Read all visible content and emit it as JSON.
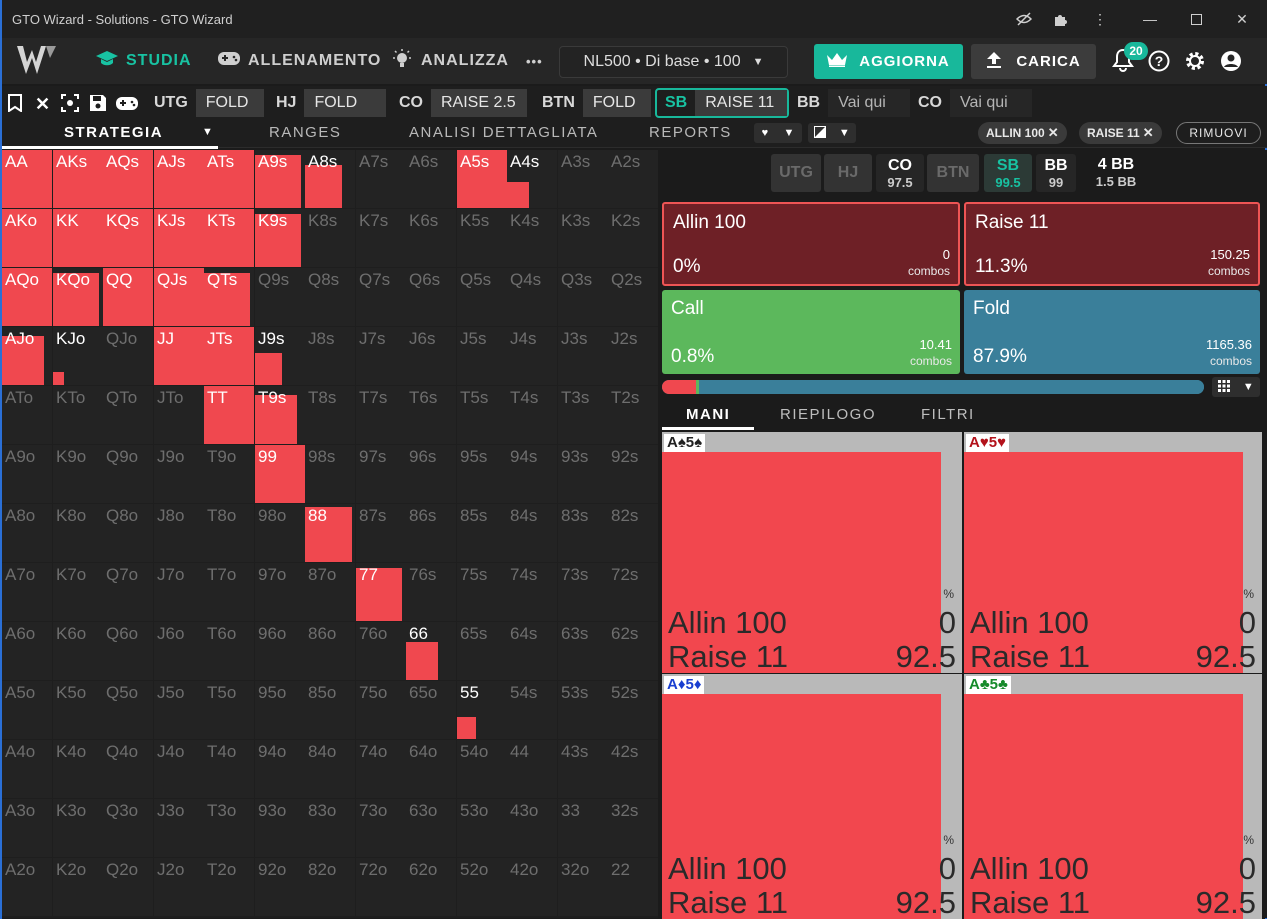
{
  "window": {
    "title": "GTO Wizard - Solutions - GTO Wizard"
  },
  "nav": {
    "studia": "STUDIA",
    "allenamento": "ALLENAMENTO",
    "analizza": "ANALIZZA",
    "more": "•••",
    "selector": "NL500 • Di base • 100",
    "aggiorna": "AGGIORNA",
    "carica": "CARICA",
    "notif_count": "20"
  },
  "actions": [
    {
      "pos": "UTG",
      "action": "FOLD"
    },
    {
      "pos": "HJ",
      "action": "FOLD"
    },
    {
      "pos": "CO",
      "action": "RAISE 2.5"
    },
    {
      "pos": "BTN",
      "action": "FOLD"
    },
    {
      "pos": "SB",
      "action": "RAISE 11"
    },
    {
      "pos": "BB",
      "action": "Vai qui"
    },
    {
      "pos": "CO",
      "action": "Vai qui"
    }
  ],
  "tabs": {
    "strategia": "STRATEGIA",
    "ranges": "RANGES",
    "analisi": "ANALISI DETTAGLIATA",
    "reports": "REPORTS"
  },
  "chips": {
    "allin": "ALLIN 100",
    "raise": "RAISE 11",
    "rimuovi": "RIMUOVI"
  },
  "colors": {
    "raise": "#f0484f",
    "call": "#5cb85c",
    "fold": "#3a7f9a",
    "allin": "#7a1f24",
    "accent": "#18b89b"
  },
  "grid": [
    [
      [
        "AA",
        1
      ],
      [
        "AKs",
        1
      ],
      [
        "AQs",
        1
      ],
      [
        "AJs",
        1
      ],
      [
        "ATs",
        1
      ],
      [
        "A9s",
        0.85
      ],
      [
        "A8s",
        0.55
      ],
      [
        "A7s",
        0
      ],
      [
        "A6s",
        0
      ],
      [
        "A5s",
        1
      ],
      [
        "A4s",
        0.2
      ],
      [
        "A3s",
        0
      ],
      [
        "A2s",
        0
      ]
    ],
    [
      [
        "AKo",
        1
      ],
      [
        "KK",
        1
      ],
      [
        "KQs",
        1
      ],
      [
        "KJs",
        1
      ],
      [
        "KTs",
        1
      ],
      [
        "K9s",
        0.85
      ],
      [
        "K8s",
        0
      ],
      [
        "K7s",
        0
      ],
      [
        "K6s",
        0
      ],
      [
        "K5s",
        0
      ],
      [
        "K4s",
        0
      ],
      [
        "K3s",
        0
      ],
      [
        "K2s",
        0
      ]
    ],
    [
      [
        "AQo",
        1
      ],
      [
        "KQo",
        0.85
      ],
      [
        "QQ",
        1
      ],
      [
        "QJs",
        1
      ],
      [
        "QTs",
        0.85
      ],
      [
        "Q9s",
        0
      ],
      [
        "Q8s",
        0
      ],
      [
        "Q7s",
        0
      ],
      [
        "Q6s",
        0
      ],
      [
        "Q5s",
        0
      ],
      [
        "Q4s",
        0
      ],
      [
        "Q3s",
        0
      ],
      [
        "Q2s",
        0
      ]
    ],
    [
      [
        "AJo",
        0.7
      ],
      [
        "KJo",
        0.05
      ],
      [
        "QJo",
        0
      ],
      [
        "JJ",
        1
      ],
      [
        "JTs",
        1
      ],
      [
        "J9s",
        0.3
      ],
      [
        "J8s",
        0
      ],
      [
        "J7s",
        0
      ],
      [
        "J6s",
        0
      ],
      [
        "J5s",
        0
      ],
      [
        "J4s",
        0
      ],
      [
        "J3s",
        0
      ],
      [
        "J2s",
        0
      ]
    ],
    [
      [
        "ATo",
        0
      ],
      [
        "KTo",
        0
      ],
      [
        "QTo",
        0
      ],
      [
        "JTo",
        0
      ],
      [
        "TT",
        1
      ],
      [
        "T9s",
        0.7
      ],
      [
        "T8s",
        0
      ],
      [
        "T7s",
        0
      ],
      [
        "T6s",
        0
      ],
      [
        "T5s",
        0
      ],
      [
        "T4s",
        0
      ],
      [
        "T3s",
        0
      ],
      [
        "T2s",
        0
      ]
    ],
    [
      [
        "A9o",
        0
      ],
      [
        "K9o",
        0
      ],
      [
        "Q9o",
        0
      ],
      [
        "J9o",
        0
      ],
      [
        "T9o",
        0
      ],
      [
        "99",
        1
      ],
      [
        "98s",
        0
      ],
      [
        "97s",
        0
      ],
      [
        "96s",
        0
      ],
      [
        "95s",
        0
      ],
      [
        "94s",
        0
      ],
      [
        "93s",
        0
      ],
      [
        "92s",
        0
      ]
    ],
    [
      [
        "A8o",
        0
      ],
      [
        "K8o",
        0
      ],
      [
        "Q8o",
        0
      ],
      [
        "J8o",
        0
      ],
      [
        "T8o",
        0
      ],
      [
        "98o",
        0
      ],
      [
        "88",
        0.9
      ],
      [
        "87s",
        0
      ],
      [
        "86s",
        0
      ],
      [
        "85s",
        0
      ],
      [
        "84s",
        0
      ],
      [
        "83s",
        0
      ],
      [
        "82s",
        0
      ]
    ],
    [
      [
        "A7o",
        0
      ],
      [
        "K7o",
        0
      ],
      [
        "Q7o",
        0
      ],
      [
        "J7o",
        0
      ],
      [
        "T7o",
        0
      ],
      [
        "97o",
        0
      ],
      [
        "87o",
        0
      ],
      [
        "77",
        0.85
      ],
      [
        "76s",
        0
      ],
      [
        "75s",
        0
      ],
      [
        "74s",
        0
      ],
      [
        "73s",
        0
      ],
      [
        "72s",
        0
      ]
    ],
    [
      [
        "A6o",
        0
      ],
      [
        "K6o",
        0
      ],
      [
        "Q6o",
        0
      ],
      [
        "J6o",
        0
      ],
      [
        "T6o",
        0
      ],
      [
        "96o",
        0
      ],
      [
        "86o",
        0
      ],
      [
        "76o",
        0
      ],
      [
        "66",
        0.42
      ],
      [
        "65s",
        0
      ],
      [
        "64s",
        0
      ],
      [
        "63s",
        0
      ],
      [
        "62s",
        0
      ]
    ],
    [
      [
        "A5o",
        0
      ],
      [
        "K5o",
        0
      ],
      [
        "Q5o",
        0
      ],
      [
        "J5o",
        0
      ],
      [
        "T5o",
        0
      ],
      [
        "95o",
        0
      ],
      [
        "85o",
        0
      ],
      [
        "75o",
        0
      ],
      [
        "65o",
        0
      ],
      [
        "55",
        0.14
      ],
      [
        "54s",
        0
      ],
      [
        "53s",
        0
      ],
      [
        "52s",
        0
      ]
    ],
    [
      [
        "A4o",
        0
      ],
      [
        "K4o",
        0
      ],
      [
        "Q4o",
        0
      ],
      [
        "J4o",
        0
      ],
      [
        "T4o",
        0
      ],
      [
        "94o",
        0
      ],
      [
        "84o",
        0
      ],
      [
        "74o",
        0
      ],
      [
        "64o",
        0
      ],
      [
        "54o",
        0
      ],
      [
        "44",
        0
      ],
      [
        "43s",
        0
      ],
      [
        "42s",
        0
      ]
    ],
    [
      [
        "A3o",
        0
      ],
      [
        "K3o",
        0
      ],
      [
        "Q3o",
        0
      ],
      [
        "J3o",
        0
      ],
      [
        "T3o",
        0
      ],
      [
        "93o",
        0
      ],
      [
        "83o",
        0
      ],
      [
        "73o",
        0
      ],
      [
        "63o",
        0
      ],
      [
        "53o",
        0
      ],
      [
        "43o",
        0
      ],
      [
        "33",
        0
      ],
      [
        "32s",
        0
      ]
    ],
    [
      [
        "A2o",
        0
      ],
      [
        "K2o",
        0
      ],
      [
        "Q2o",
        0
      ],
      [
        "J2o",
        0
      ],
      [
        "T2o",
        0
      ],
      [
        "92o",
        0
      ],
      [
        "82o",
        0
      ],
      [
        "72o",
        0
      ],
      [
        "62o",
        0
      ],
      [
        "52o",
        0
      ],
      [
        "42o",
        0
      ],
      [
        "32o",
        0
      ],
      [
        "22",
        0
      ]
    ]
  ],
  "positions": [
    {
      "label": "UTG",
      "stack": ""
    },
    {
      "label": "HJ",
      "stack": ""
    },
    {
      "label": "CO",
      "stack": "97.5"
    },
    {
      "label": "BTN",
      "stack": ""
    },
    {
      "label": "SB",
      "stack": "99.5"
    },
    {
      "label": "BB",
      "stack": "99"
    }
  ],
  "pot": {
    "main": "4 BB",
    "sub": "1.5 BB"
  },
  "stats": [
    {
      "name": "Allin 100",
      "pct": "0%",
      "combos": "0",
      "word": "combos"
    },
    {
      "name": "Raise 11",
      "pct": "11.3%",
      "combos": "150.25",
      "word": "combos"
    },
    {
      "name": "Call",
      "pct": "0.8%",
      "combos": "10.41",
      "word": "combos"
    },
    {
      "name": "Fold",
      "pct": "87.9%",
      "combos": "1165.36",
      "word": "combos"
    }
  ],
  "freq_bar": {
    "raise": 0.113,
    "call": 0.008,
    "fold": 0.879
  },
  "hand_tabs": {
    "mani": "MANI",
    "riepilogo": "RIEPILOGO",
    "filtri": "FILTRI"
  },
  "hands": [
    {
      "card": "A♠5♠",
      "suit_color": "#222222",
      "l1": "Allin 100",
      "v1": "0",
      "l2": "Raise 11",
      "v2": "92.5",
      "pct": "%"
    },
    {
      "card": "A♥5♥",
      "suit_color": "#b3121b",
      "l1": "Allin 100",
      "v1": "0",
      "l2": "Raise 11",
      "v2": "92.5",
      "pct": "%"
    },
    {
      "card": "A♦5♦",
      "suit_color": "#1a3fd0",
      "l1": "Allin 100",
      "v1": "0",
      "l2": "Raise 11",
      "v2": "92.5",
      "pct": "%"
    },
    {
      "card": "A♣5♣",
      "suit_color": "#168a2a",
      "l1": "Allin 100",
      "v1": "0",
      "l2": "Raise 11",
      "v2": "92.5",
      "pct": "%"
    }
  ]
}
